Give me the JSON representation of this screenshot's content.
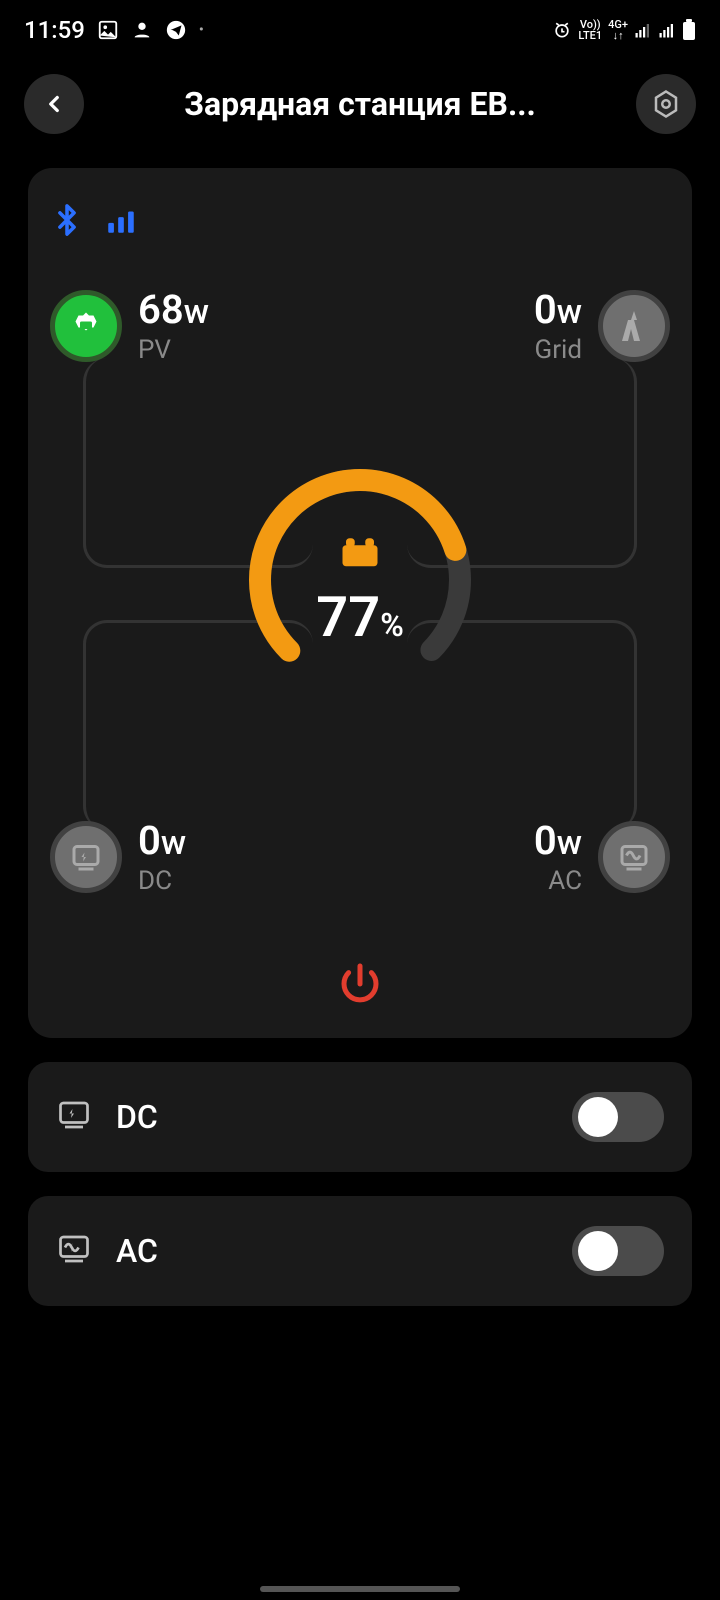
{
  "status": {
    "time": "11:59",
    "net_label": "LTE1",
    "net_type": "4G+",
    "vo": "Vo))"
  },
  "header": {
    "title": "Зарядная станция EB..."
  },
  "flow": {
    "pv": {
      "watt": "68",
      "unit": "w",
      "label": "PV"
    },
    "grid": {
      "watt": "0",
      "unit": "w",
      "label": "Grid"
    },
    "dc": {
      "watt": "0",
      "unit": "w",
      "label": "DC"
    },
    "ac": {
      "watt": "0",
      "unit": "w",
      "label": "AC"
    },
    "battery_pct": "77",
    "pct_symbol": "%"
  },
  "toggles": {
    "dc": {
      "label": "DC",
      "on": false
    },
    "ac": {
      "label": "AC",
      "on": false
    }
  }
}
